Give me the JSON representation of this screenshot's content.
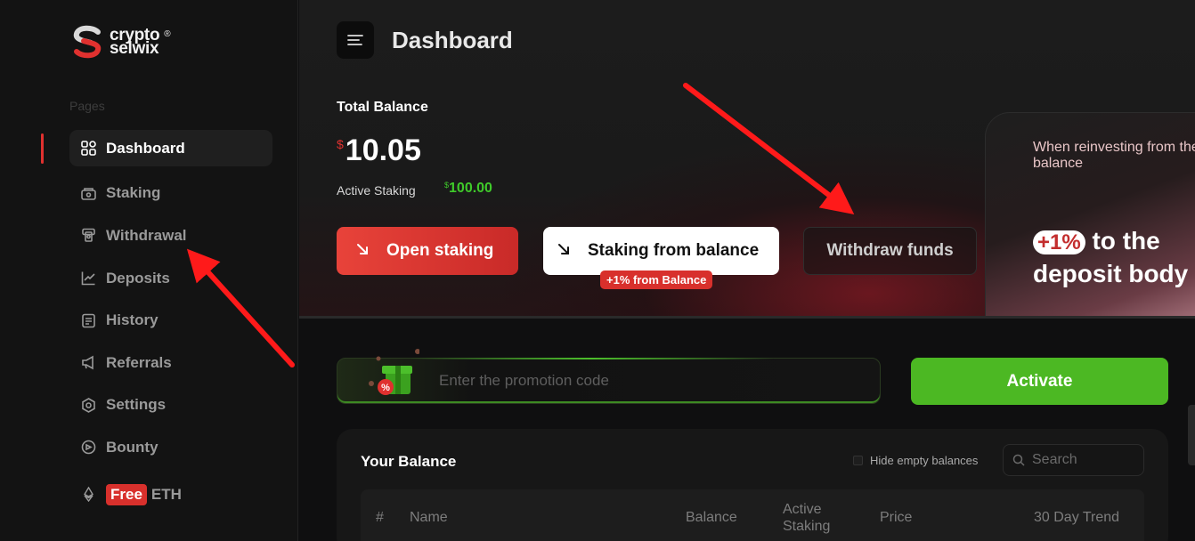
{
  "brand": {
    "line1": "crypto",
    "line2": "selwix",
    "reg": "®"
  },
  "sidebar": {
    "section_label": "Pages",
    "items": [
      {
        "label": "Dashboard",
        "icon": "dashboard-icon",
        "active": true
      },
      {
        "label": "Staking",
        "icon": "staking-icon"
      },
      {
        "label": "Withdrawal",
        "icon": "withdrawal-icon"
      },
      {
        "label": "Deposits",
        "icon": "chart-icon"
      },
      {
        "label": "History",
        "icon": "history-icon"
      },
      {
        "label": "Referrals",
        "icon": "megaphone-icon"
      },
      {
        "label": "Settings",
        "icon": "gear-icon"
      },
      {
        "label": "Bounty",
        "icon": "bounty-icon"
      }
    ],
    "free_eth": {
      "badge": "Free",
      "label": "ETH",
      "icon": "ethereum-icon"
    }
  },
  "header": {
    "title": "Dashboard"
  },
  "balance": {
    "label": "Total Balance",
    "currency": "$",
    "value": "10.05",
    "active_staking_label": "Active Staking",
    "active_staking_currency": "$",
    "active_staking_value": "100.00"
  },
  "actions": {
    "open_staking": "Open staking",
    "staking_from_balance": "Staking from balance",
    "staking_bonus": "+1% from Balance",
    "withdraw": "Withdraw funds"
  },
  "promo_card": {
    "small_text": "When reinvesting from the balance",
    "badge": "+1%",
    "big_text_1": "to the",
    "big_text_2": "deposit body"
  },
  "promo": {
    "placeholder": "Enter the promotion code",
    "button": "Activate"
  },
  "your_balance": {
    "title": "Your Balance",
    "hide_empty": "Hide empty balances",
    "search_placeholder": "Search",
    "columns": [
      "#",
      "Name",
      "Balance",
      "Active Staking",
      "Price",
      "30 Day Trend"
    ]
  },
  "colors": {
    "accent_red": "#e0312f",
    "accent_green": "#4cb823",
    "bg": "#0f0f10"
  }
}
